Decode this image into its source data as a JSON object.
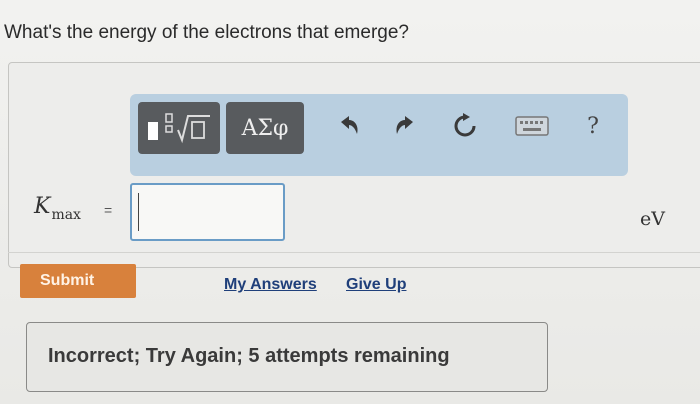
{
  "question": "What's the energy of the electrons that emerge?",
  "toolbar": {
    "greek_label": "ΑΣφ",
    "help_label": "?"
  },
  "answer": {
    "variable": "K",
    "subscript": "max",
    "equals": "=",
    "value": "",
    "unit": "eV"
  },
  "actions": {
    "submit_label": "Submit",
    "my_answers_label": "My Answers",
    "give_up_label": "Give Up"
  },
  "feedback": {
    "message": "Incorrect; Try Again; 5 attempts remaining"
  },
  "colors": {
    "toolbar_bg": "#b9cfe0",
    "submit_bg": "#d8813c",
    "link": "#1f3f7a",
    "input_border": "#6a9cc6"
  }
}
